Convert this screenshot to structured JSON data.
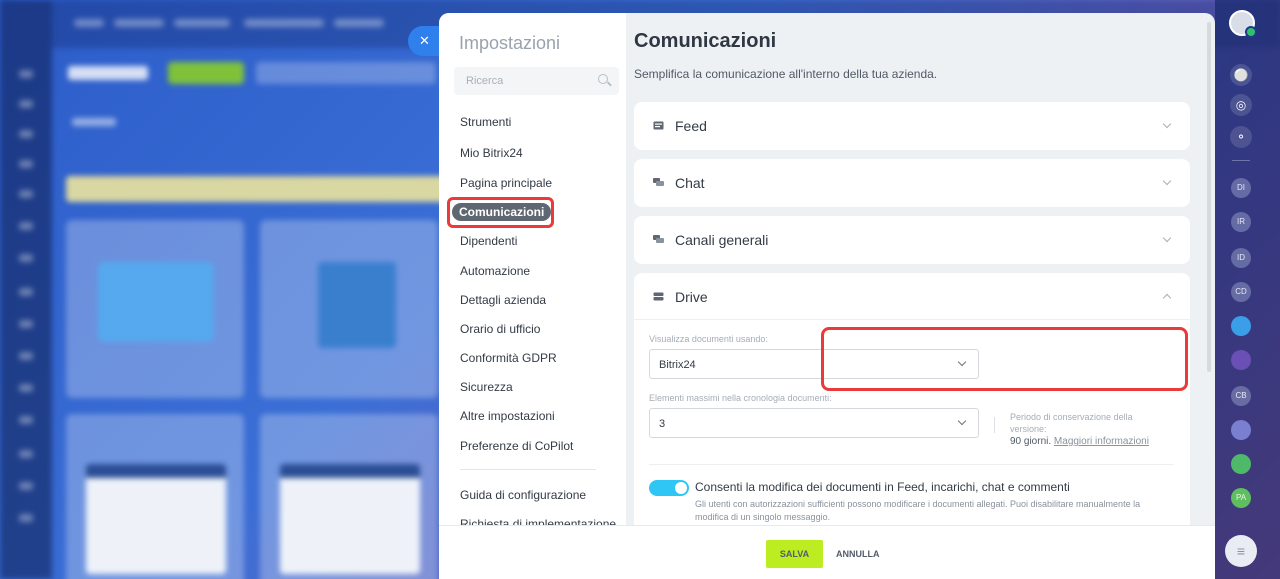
{
  "settings": {
    "title": "Impostazioni",
    "search_placeholder": "Ricerca",
    "nav_items": [
      "Strumenti",
      "Mio Bitrix24",
      "Pagina principale",
      "Comunicazioni",
      "Dipendenti",
      "Automazione",
      "Dettagli azienda",
      "Orario di ufficio",
      "Conformità GDPR",
      "Sicurezza",
      "Altre impostazioni",
      "Preferenze di CoPilot"
    ],
    "nav_secondary": [
      "Guida di configurazione",
      "Richiesta di implementazione"
    ],
    "active_item": "Comunicazioni"
  },
  "page": {
    "title": "Comunicazioni",
    "subtitle": "Semplifica la comunicazione all'interno della tua azienda."
  },
  "sections": [
    {
      "title": "Feed",
      "icon": "feed-icon",
      "expanded": false
    },
    {
      "title": "Chat",
      "icon": "chat-icon",
      "expanded": false
    },
    {
      "title": "Canali generali",
      "icon": "channels-icon",
      "expanded": false
    },
    {
      "title": "Drive",
      "icon": "drive-icon",
      "expanded": true
    }
  ],
  "drive": {
    "view_label": "Visualizza documenti usando:",
    "view_value": "Bitrix24",
    "history_label": "Elementi massimi nella cronologia documenti:",
    "history_value": "3",
    "retention_label": "Periodo di conservazione della versione:",
    "retention_value": "90 giorni.",
    "retention_link": "Maggiori informazioni",
    "toggle_title": "Consenti la modifica dei documenti in Feed, incarichi, chat e commenti",
    "toggle_desc": "Gli utenti con autorizzazioni sufficienti possono modificare i documenti allegati. Puoi disabilitare manualmente la modifica di un singolo messaggio.",
    "toggle_on": true
  },
  "footer": {
    "save": "SALVA",
    "cancel": "ANNULLA"
  },
  "rightbar": {
    "chats": [
      "DI",
      "IR",
      "ID",
      "CD",
      "CB",
      "PA"
    ]
  },
  "colors": {
    "accent": "#2f80ed",
    "save": "#bbed21",
    "toggle": "#2fc6f6",
    "highlight": "#ea3a3a",
    "active_nav": "#5e6772"
  }
}
